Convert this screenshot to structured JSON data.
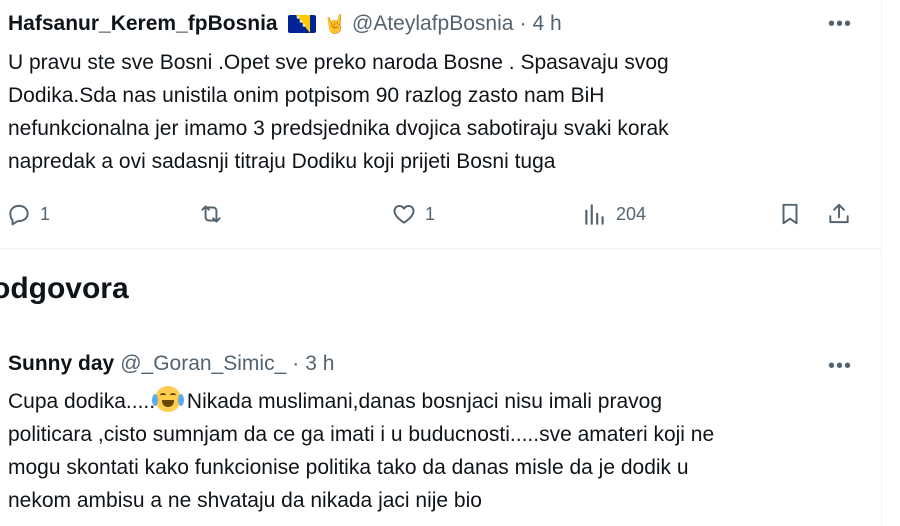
{
  "tweet1": {
    "name": "Hafsanur_Kerem_fpBosnia",
    "handle": "@AteylafpBosnia",
    "separator": "·",
    "time": "4 h",
    "more": "•••",
    "text": "U pravu ste sve Bosni .Opet sve preko naroda Bosne . Spasavaju svog\nDodika.Sda nas unistila onim potpisom 90 razlog zasto nam BiH\nnefunkcionalna jer imamo 3 predsjednika dvojica sabotiraju svaki korak\nnapredak a ovi sadasnji titraju Dodiku koji prijeti Bosni tuga",
    "actions": {
      "replies": "1",
      "reposts": "",
      "likes": "1",
      "views": "204"
    },
    "icons": [
      "bosnia-flag-icon",
      "rock-hand-icon",
      "reply-icon",
      "repost-icon",
      "like-icon",
      "views-icon",
      "bookmark-icon",
      "share-icon"
    ]
  },
  "section": {
    "title": "odgovora"
  },
  "tweet2": {
    "name": "Sunny day",
    "handle": "@_Goran_Simic_",
    "separator": "·",
    "time": "3 h",
    "more": "•••",
    "text_before_emoji": "Cupa dodika.....",
    "text_after_emoji": " Nikada muslimani,danas bosnjaci nisu imali pravog\npoliticara ,cisto sumnjam da ce ga imati i u buducnosti.....sve amateri koji ne\nmogu skontati kako funkcionise politika tako da danas misle da je dodik u\nnekom ambisu a ne shvataju da nikada jaci nije bio",
    "emoji": "face-with-tears-of-joy-icon"
  },
  "colors": {
    "text": "#0f1419",
    "muted": "#536471",
    "border": "#eff3f4"
  }
}
